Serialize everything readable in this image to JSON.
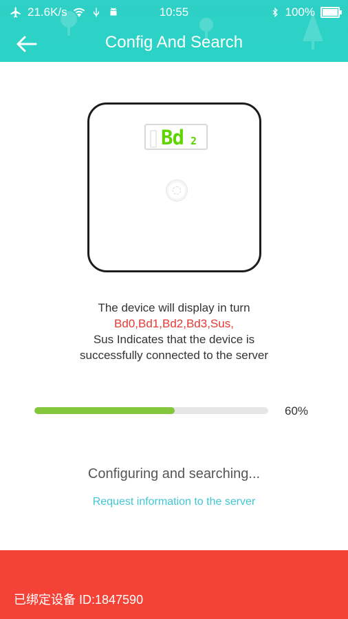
{
  "status_bar": {
    "speed": "21.6K/s",
    "time": "10:55",
    "battery": "100%",
    "icons": [
      "airplane-icon",
      "wifi-icon",
      "usb-icon",
      "android-icon",
      "bluetooth-icon",
      "battery-icon"
    ]
  },
  "nav": {
    "title": "Config And Search",
    "back_icon": "arrow-left-icon"
  },
  "scale_display": {
    "main": "Bd",
    "small": "2"
  },
  "instructions": {
    "line1": "The device will display in turn",
    "line2": "Bd0,Bd1,Bd2,Bd3,Sus,",
    "line3": "Sus Indicates that the device is",
    "line4": "successfully connected to the server"
  },
  "progress": {
    "value": 60,
    "label": "60%"
  },
  "status_text": "Configuring and searching...",
  "request_text": "Request information to the server",
  "footer": {
    "bound_device": "已绑定设备 ID:1847590"
  },
  "colors": {
    "header": "#2ad3c6",
    "progress": "#83c63b",
    "highlight": "#e53935",
    "link": "#3fc7d6",
    "footer": "#f44336"
  }
}
